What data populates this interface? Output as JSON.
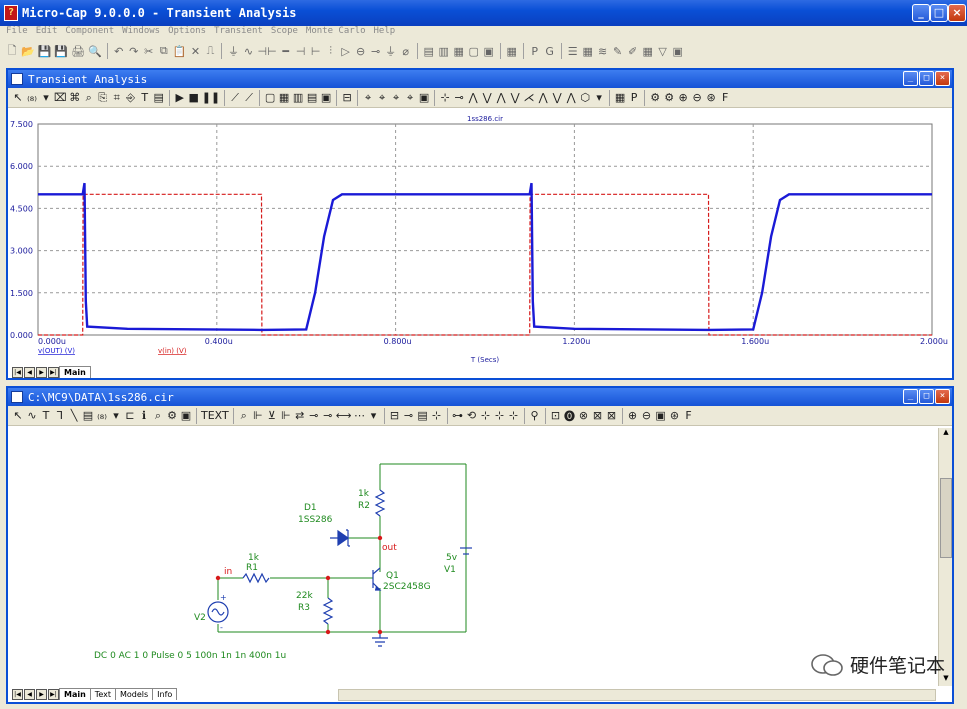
{
  "app": {
    "title": "Micro-Cap 9.0.0.0 - Transient Analysis",
    "window_buttons": [
      "_",
      "□",
      "×"
    ]
  },
  "menu": [
    "File",
    "Edit",
    "Component",
    "Windows",
    "Options",
    "Transient",
    "Scope",
    "Monte Carlo",
    "Help"
  ],
  "main_toolbar": [
    "🗋",
    "📂",
    "💾",
    "💾",
    "🖨",
    "🔍",
    "↶",
    "↷",
    "✂",
    "⧉",
    "📋",
    "✕",
    "⎍",
    "⏚",
    "∿",
    "⊣⊢",
    "━",
    "⊣",
    "⊢",
    "⫶",
    "▷",
    "⊖",
    "⊸",
    "⏚",
    "⌀",
    "▤",
    "▥",
    "▦",
    "▢",
    "▣",
    "▦",
    "P",
    "G",
    "☰",
    "▦",
    "≋",
    "✎",
    "✐",
    "▦",
    "▽",
    "▣"
  ],
  "transient": {
    "window_title": "Transient Analysis",
    "toolbar": [
      "↖",
      "₍₈₎",
      "▾",
      "⌧",
      "⌘",
      "⌕",
      "⎘",
      "⌗",
      "⎆",
      "T",
      "▤",
      "▶",
      "■",
      "❚❚",
      "⟋",
      "⟋",
      "▢",
      "▦",
      "▥",
      "▤",
      "▣",
      "⊟",
      "⌖",
      "⌖",
      "⌖",
      "⌖",
      "▣",
      "⊹",
      "⊸",
      "⋀",
      "⋁",
      "⋀",
      "⋁",
      "⋌",
      "⋀",
      "⋁",
      "⋀",
      "⬡",
      "▾",
      "▦",
      "P",
      "⚙",
      "⚙",
      "⊕",
      "⊖",
      "⊛",
      "F"
    ],
    "tabs": [
      "Main"
    ],
    "chart_data": {
      "type": "line",
      "title": "1ss286.cir",
      "xlabel": "T (Secs)",
      "xlim": [
        0,
        2.0
      ],
      "ylim": [
        0,
        7.5
      ],
      "y_ticks": [
        "0.000",
        "1.500",
        "3.000",
        "4.500",
        "6.000",
        "7.500"
      ],
      "x_ticks": [
        "0.000u",
        "0.400u",
        "0.800u",
        "1.200u",
        "1.600u",
        "2.000u"
      ],
      "legend": [
        "v(OUT) (V)",
        "v(in) (V)"
      ],
      "grid": true,
      "series": [
        {
          "name": "v(OUT) (V)",
          "color": "#1a1ad6",
          "points": [
            [
              0,
              5.0
            ],
            [
              0.1,
              5.0
            ],
            [
              0.104,
              5.4
            ],
            [
              0.107,
              1.2
            ],
            [
              0.11,
              0.3
            ],
            [
              0.2,
              0.22
            ],
            [
              0.5,
              0.18
            ],
            [
              0.6,
              0.2
            ],
            [
              0.62,
              1.5
            ],
            [
              0.64,
              3.5
            ],
            [
              0.66,
              4.8
            ],
            [
              0.68,
              5.0
            ],
            [
              1.1,
              5.0
            ],
            [
              1.104,
              5.4
            ],
            [
              1.107,
              1.2
            ],
            [
              1.11,
              0.3
            ],
            [
              1.2,
              0.22
            ],
            [
              1.5,
              0.18
            ],
            [
              1.6,
              0.2
            ],
            [
              1.62,
              1.5
            ],
            [
              1.64,
              3.5
            ],
            [
              1.66,
              4.8
            ],
            [
              1.68,
              5.0
            ],
            [
              2.0,
              5.0
            ]
          ]
        },
        {
          "name": "v(in) (V)",
          "color": "#d61a1a",
          "points": [
            [
              0,
              0
            ],
            [
              0.1,
              0
            ],
            [
              0.101,
              5.0
            ],
            [
              0.5,
              5.0
            ],
            [
              0.501,
              0
            ],
            [
              1.1,
              0
            ],
            [
              1.101,
              5.0
            ],
            [
              1.5,
              5.0
            ],
            [
              1.501,
              0
            ],
            [
              2.0,
              0
            ]
          ]
        }
      ]
    }
  },
  "schematic": {
    "window_title": "C:\\MC9\\DATA\\1ss286.cir",
    "toolbar": [
      "↖",
      "∿",
      "T",
      "ꓶ",
      "╲",
      "▤",
      "₍₈₎",
      "▾",
      "⊏",
      "ℹ",
      "⌕",
      "⚙",
      "▣",
      "TEXT",
      "⌕",
      "⊩",
      "⊻",
      "⊩",
      "⇄",
      "⊸",
      "⊸",
      "⟷",
      "⋯",
      "▾",
      "⊟",
      "⊸",
      "▤",
      "⊹",
      "⊶",
      "⟲",
      "⊹",
      "⊹",
      "⊹",
      "⚲",
      "⊡",
      "⓿",
      "⊗",
      "⊠",
      "⊠",
      "⊕",
      "⊖",
      "▣",
      "⊛",
      "F"
    ],
    "components": {
      "d1_name": "D1",
      "d1_model": "1SS286",
      "r1_value": "1k",
      "r1_name": "R1",
      "r2_value": "1k",
      "r2_name": "R2",
      "r3_value": "22k",
      "r3_name": "R3",
      "q1_name": "Q1",
      "q1_model": "2SC2458G",
      "v1_value": "5v",
      "v1_name": "V1",
      "v2_name": "V2",
      "node_in": "in",
      "node_out": "out",
      "plus": "+",
      "minus": "-"
    },
    "source_text": "DC 0 AC 1 0 Pulse 0 5 100n 1n 1n 400n 1u",
    "tabs": [
      "Main",
      "Text",
      "Models",
      "Info"
    ]
  },
  "watermark": "硬件笔记本"
}
